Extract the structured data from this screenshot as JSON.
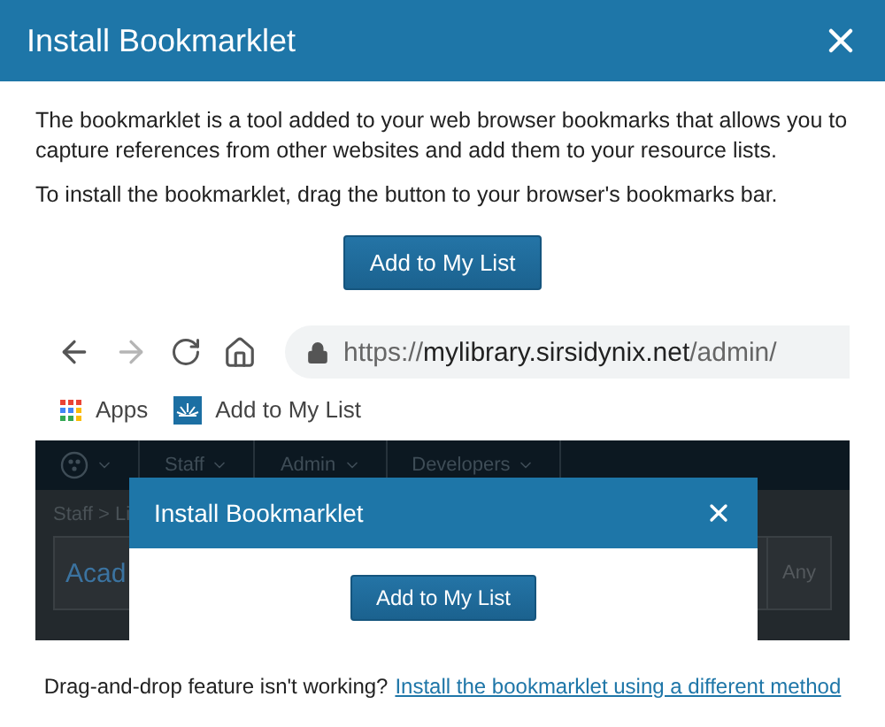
{
  "dialog": {
    "title": "Install Bookmarklet",
    "paragraphs": [
      "The bookmarklet is a tool added to your web browser bookmarks that allows you to capture references from other websites and add them to your resource lists.",
      "To install the bookmarklet, drag the button to your browser's bookmarks bar."
    ],
    "button": "Add to My List",
    "footer": {
      "text": "Drag-and-drop feature isn't working?",
      "link": "Install the bookmarklet using a different method"
    }
  },
  "illustration": {
    "browser": {
      "forward_disabled": true,
      "url": {
        "scheme": "https://",
        "host": "mylibrary.sirsidynix.net",
        "path": "/admin/"
      },
      "bookmarks": [
        {
          "kind": "apps",
          "label": "Apps"
        },
        {
          "kind": "bookmarklet",
          "label": "Add to My List"
        }
      ]
    },
    "app": {
      "nav": [
        "Staff",
        "Admin",
        "Developers"
      ],
      "breadcrumb": "Staff > Li",
      "heading": "Acad",
      "filter": "Any"
    },
    "modal": {
      "title": "Install Bookmarklet",
      "button": "Add to My List"
    }
  }
}
